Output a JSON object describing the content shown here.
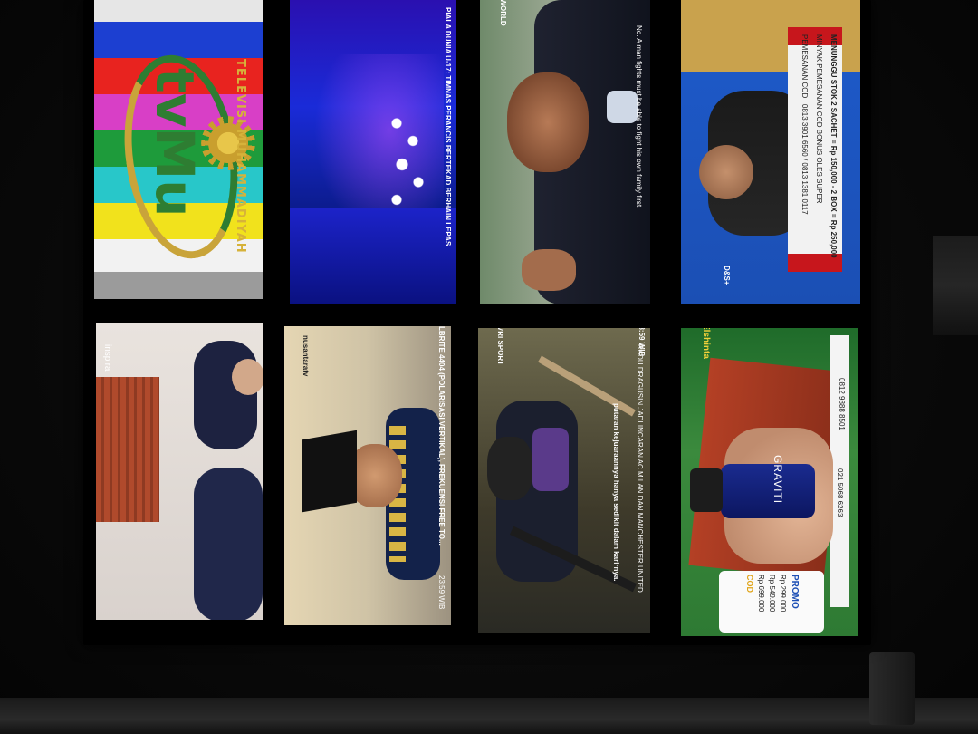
{
  "screens": {
    "tvmu": {
      "logo": "tvMu",
      "name": "TELEVISI MUHAMMADIYAH",
      "bar_colors": [
        "#1c3fd1",
        "#e8231f",
        "#d83fc6",
        "#1e9b3b",
        "#28c7c9",
        "#f1e21c",
        "#f2f2f2",
        "#9b9b9b"
      ]
    },
    "stage": {
      "ticker": "PIALA DUNIA U-17: TIMNAS PERANCIS BERTEKAD BERHAIN LEPAS"
    },
    "world": {
      "channel": "TVRI WORLD",
      "subtitle": "No. A man fights must be able to fight his own family first."
    },
    "studio": {
      "channel": "D&S+",
      "ad_lines": [
        "MENUNGGU STOK 2 SACHET = Rp 150,000 - 2 BOX = Rp 250,000",
        "MINYAK PEMESANAN COD BONUS OLES SUPER",
        "PEMESANAN COD : 0813 3901 6560 / 0813 1381 0117"
      ]
    },
    "inspira": {
      "channel": "inspira"
    },
    "nusantara": {
      "channel": "nusantaratv",
      "ticker": "LBRITE 4404 (POLARISASI VERTIKAL), FREKUENSI FREE TO...",
      "time": "23:59 WIB"
    },
    "sport": {
      "channel": "TVRI SPORT",
      "caption": "putaran kejuaraannya hanya sedikit dalam karirnya.",
      "ticker": "RADU DRAGUSIN JADI INCARAN AC MILAN DAN MANCHESTER UNITED",
      "time": "23:59 WIB"
    },
    "product": {
      "channel": "Elshinta",
      "brand": "GRAVITI",
      "phone1": "0812 9888 8501",
      "phone2": "021 5068 6263",
      "promo": "PROMO",
      "prices": [
        "Rp 299.000",
        "Rp 549.000",
        "Rp 699.000"
      ],
      "cod": "COD"
    }
  }
}
